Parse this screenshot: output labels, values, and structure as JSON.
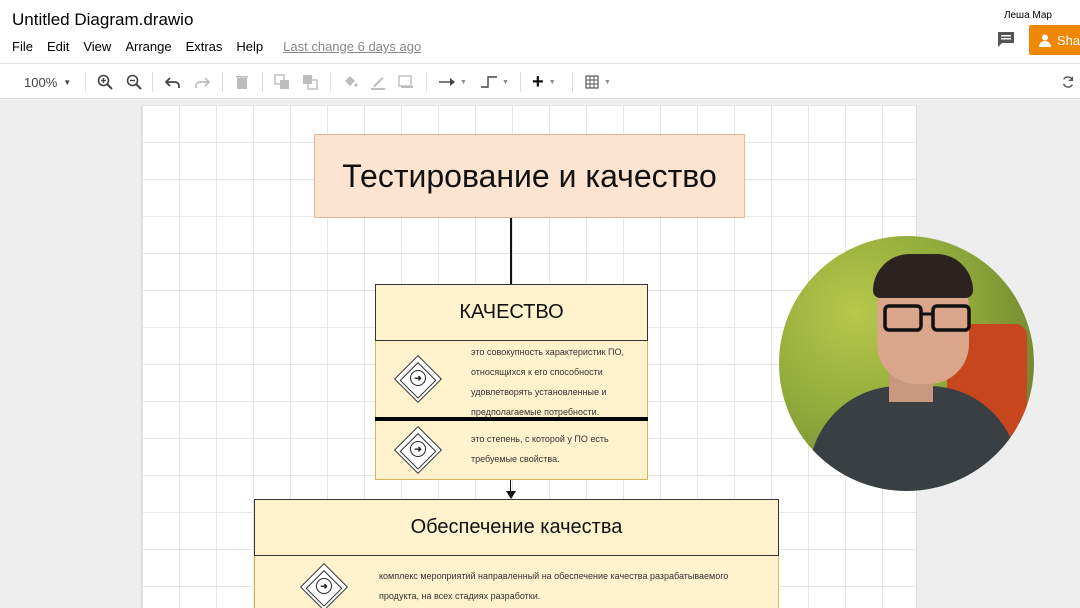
{
  "header": {
    "doc_title": "Untitled Diagram.drawio",
    "menu": [
      "File",
      "Edit",
      "View",
      "Arrange",
      "Extras",
      "Help"
    ],
    "last_change": "Last change 6 days ago",
    "user_name": "Леша Мар",
    "share_label": "Sha"
  },
  "toolbar": {
    "zoom": "100%"
  },
  "diagram": {
    "title": "Тестирование и качество",
    "quality_heading": "КАЧЕСТВО",
    "quality_def1_lines": [
      "это совокупность характеристик ПО,",
      "относящихся к его способности",
      "удовлетворять установленные и",
      "предполагаемые потребности."
    ],
    "quality_def2_lines": [
      "это степень, с которой у ПО есть",
      "требуемые свойства."
    ],
    "assurance_heading": "Обеспечение качества",
    "assurance_def_lines": [
      "комплекс мероприятий направленный на обеспечение качества разрабатываемого",
      "продукта, на всех стадиях разработки."
    ]
  },
  "colors": {
    "share_orange": "#f08705",
    "title_fill": "#fde4d0",
    "block_fill": "#fff2cc"
  }
}
